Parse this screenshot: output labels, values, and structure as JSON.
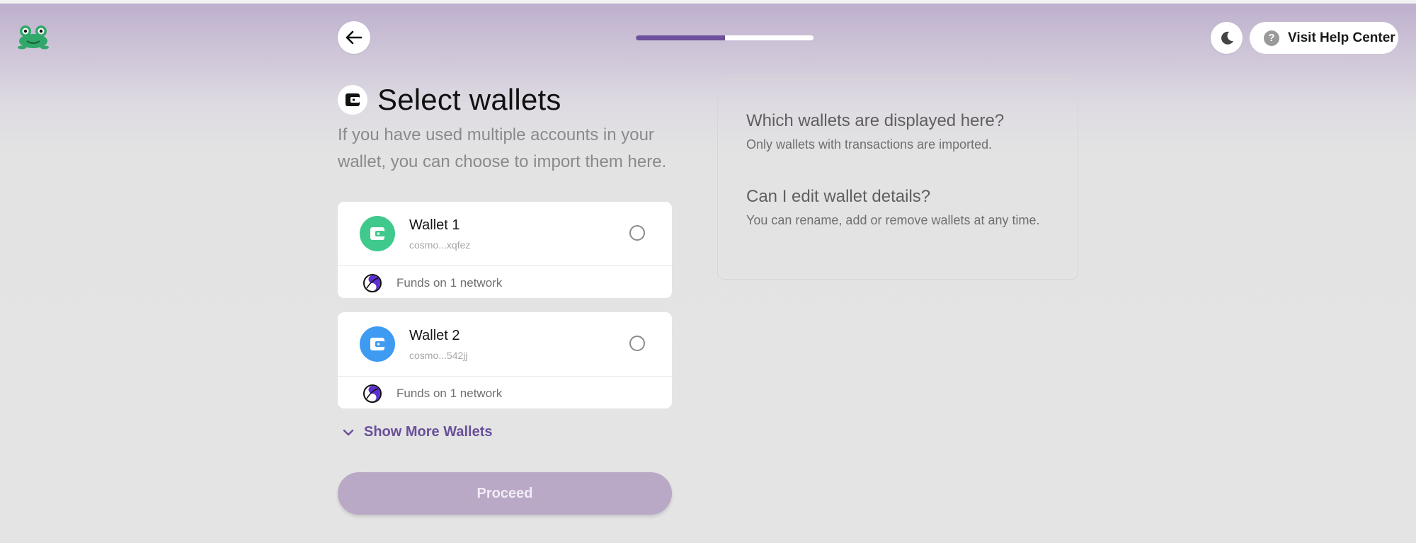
{
  "header": {
    "progress_fraction": 0.5,
    "help_label": "Visit Help Center"
  },
  "main": {
    "title": "Select wallets",
    "subtitle": "If you have used multiple accounts in your wallet, you can choose to import them here.",
    "wallets": [
      {
        "name": "Wallet 1",
        "address": "cosmo...xqfez",
        "funds": "Funds on 1 network",
        "color": "#3fc98c"
      },
      {
        "name": "Wallet 2",
        "address": "cosmo...542jj",
        "funds": "Funds on 1 network",
        "color": "#3f9af2"
      }
    ],
    "show_more_label": "Show More Wallets",
    "proceed_label": "Proceed"
  },
  "faq": {
    "q1": "Which wallets are displayed here?",
    "a1": "Only wallets with transactions are imported.",
    "q2": "Can I edit wallet details?",
    "a2": "You can rename, add or remove wallets at any time."
  },
  "colors": {
    "accent": "#6d4f9c",
    "proceed_disabled": "#b9a9c7"
  },
  "icons": {
    "logo": "frog-logo-icon",
    "back": "arrow-left-icon",
    "theme": "moon-icon",
    "help": "question-circle-icon",
    "wallet": "wallet-icon",
    "network": "network-icon",
    "chevron": "chevron-down-icon"
  }
}
